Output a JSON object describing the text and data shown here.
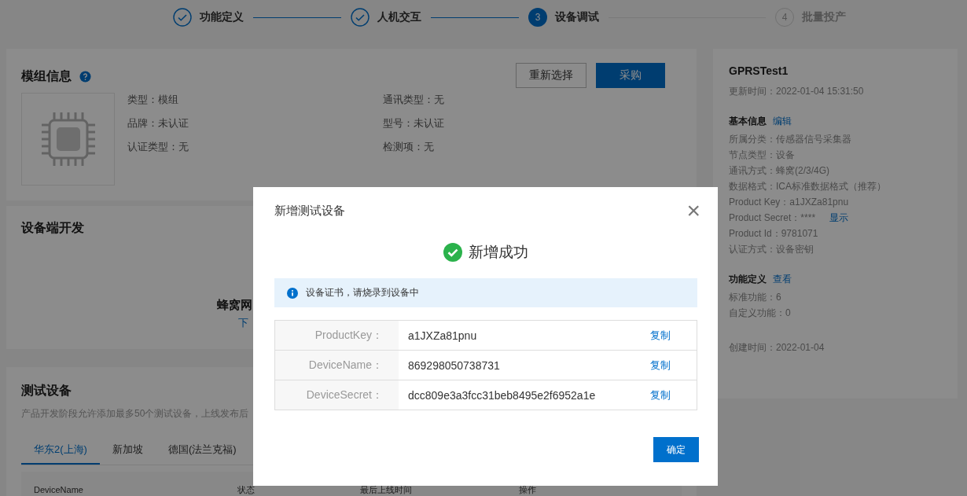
{
  "steps": [
    {
      "label": "功能定义",
      "kind": "done"
    },
    {
      "label": "人机交互",
      "kind": "done"
    },
    {
      "number": "3",
      "label": "设备调试",
      "kind": "active"
    },
    {
      "number": "4",
      "label": "批量投产",
      "kind": "pending"
    }
  ],
  "module_card": {
    "title": "模组信息",
    "buttons": [
      {
        "label": "重新选择",
        "kind": "secondary"
      },
      {
        "label": "采购",
        "kind": "primary"
      }
    ],
    "fields": [
      {
        "label": "类型：",
        "value": "模组"
      },
      {
        "label": "通讯类型：",
        "value": "无"
      },
      {
        "label": "品牌：",
        "value": "未认证"
      },
      {
        "label": "型号：",
        "value": "未认证"
      },
      {
        "label": "认证类型：",
        "value": "无"
      },
      {
        "label": "检测项：",
        "value": "无"
      }
    ]
  },
  "device_dev_card": {
    "title": "设备端开发",
    "name": "蜂窝网",
    "link": "下"
  },
  "test_devices_card": {
    "title": "测试设备",
    "description": "产品开发阶段允许添加最多50个测试设备，上线发布后",
    "tabs": [
      {
        "label": "华东2(上海)",
        "selected": true
      },
      {
        "label": "新加坡",
        "selected": false
      },
      {
        "label": "德国(法兰克福)",
        "selected": false
      }
    ],
    "columns": [
      "DeviceName",
      "状态",
      "最后上线时间",
      "操作"
    ]
  },
  "product_panel": {
    "name": "GPRSTest1",
    "updated": "更新时间：2022-01-04 15:31:50",
    "sections": [
      {
        "title": "基本信息",
        "link": "编辑",
        "lines": [
          {
            "text": "所属分类：传感器信号采集器"
          },
          {
            "text": "节点类型：设备"
          },
          {
            "text": "通讯方式：蜂窝(2/3/4G)"
          },
          {
            "text": "数据格式：ICA标准数据格式（推荐）"
          },
          {
            "text": "Product Key：a1JXZa81pnu"
          },
          {
            "text": "Product Secret：****",
            "action": "显示"
          },
          {
            "text": "Product Id：9781071"
          },
          {
            "text": "认证方式：设备密钥"
          }
        ]
      },
      {
        "title": "功能定义",
        "link": "查看",
        "lines": [
          {
            "text": "标准功能：6"
          },
          {
            "text": "自定义功能：0"
          }
        ]
      }
    ],
    "created": "创建时间：2022-01-04"
  },
  "dialog": {
    "title": "新增测试设备",
    "close": "×",
    "result": "新增成功",
    "notice": "设备证书，请烧录到设备中",
    "rows": [
      {
        "label": "ProductKey：",
        "value": "a1JXZa81pnu",
        "action": "复制"
      },
      {
        "label": "DeviceName：",
        "value": "869298050738731",
        "action": "复制"
      },
      {
        "label": "DeviceSecret：",
        "value": "dcc809e3a3fcc31beb8495e2f6952a1e",
        "action": "复制"
      }
    ],
    "confirm": "确定"
  }
}
